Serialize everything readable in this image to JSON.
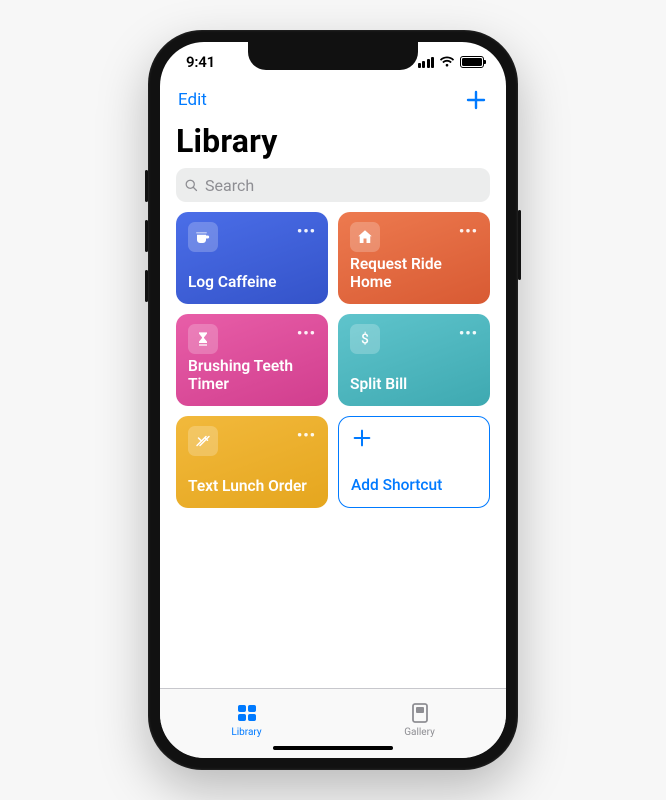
{
  "status": {
    "time": "9:41"
  },
  "nav": {
    "edit": "Edit"
  },
  "title": "Library",
  "search": {
    "placeholder": "Search"
  },
  "shortcuts": [
    {
      "title": "Log Caffeine",
      "icon": "mug",
      "color1": "#4b6ee8",
      "color2": "#3453c9"
    },
    {
      "title": "Request Ride Home",
      "icon": "home",
      "color1": "#ed7a4f",
      "color2": "#d85a33"
    },
    {
      "title": "Brushing Teeth Timer",
      "icon": "hourglass",
      "color1": "#e85ea8",
      "color2": "#d13e8e"
    },
    {
      "title": "Split Bill",
      "icon": "dollar",
      "color1": "#5fc4cc",
      "color2": "#3ea9b1"
    },
    {
      "title": "Text Lunch Order",
      "icon": "utensils",
      "color1": "#f2b93c",
      "color2": "#e5a61e"
    }
  ],
  "add_card": {
    "label": "Add Shortcut"
  },
  "tabs": [
    {
      "label": "Library",
      "icon": "grid",
      "active": true
    },
    {
      "label": "Gallery",
      "icon": "gallery",
      "active": false
    }
  ]
}
